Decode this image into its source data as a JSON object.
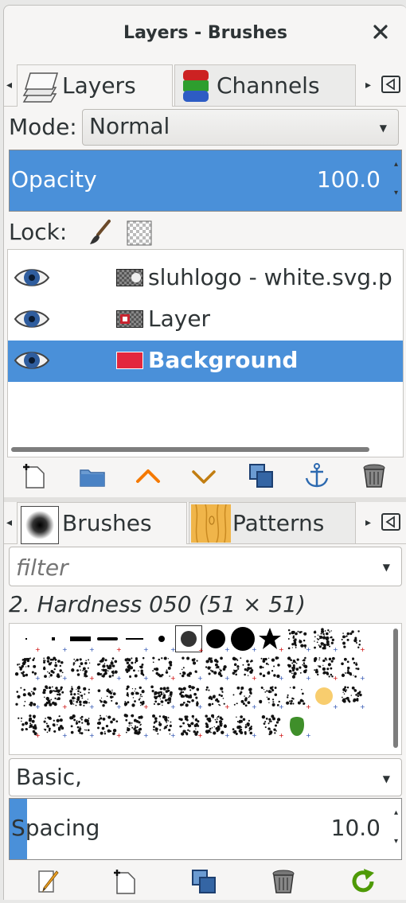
{
  "window": {
    "title": "Layers - Brushes",
    "close_icon": "close-icon"
  },
  "layers_dock": {
    "tabs": [
      {
        "label": "Layers",
        "icon": "layers-icon"
      },
      {
        "label": "Channels",
        "icon": "channels-icon"
      }
    ],
    "mode_label": "Mode:",
    "mode_value": "Normal",
    "opacity_label": "Opacity",
    "opacity_value": "100.0",
    "opacity_fraction": 1.0,
    "lock_label": "Lock:",
    "layers": [
      {
        "name": "sluhlogo - white.svg.p",
        "visible": true,
        "selected": false
      },
      {
        "name": "Layer",
        "visible": true,
        "selected": false
      },
      {
        "name": "Background",
        "visible": true,
        "selected": true
      }
    ],
    "selected_color": "#4a90d9"
  },
  "brushes_dock": {
    "tabs": [
      {
        "label": "Brushes",
        "icon": "brush-preview-icon"
      },
      {
        "label": "Patterns",
        "icon": "pattern-preview-icon"
      }
    ],
    "filter_placeholder": "filter",
    "brush_name": "2. Hardness 050 (51 × 51)",
    "preset_value": "Basic,",
    "spacing_label": "Spacing",
    "spacing_value": "10.0",
    "spacing_fraction": 0.1
  }
}
